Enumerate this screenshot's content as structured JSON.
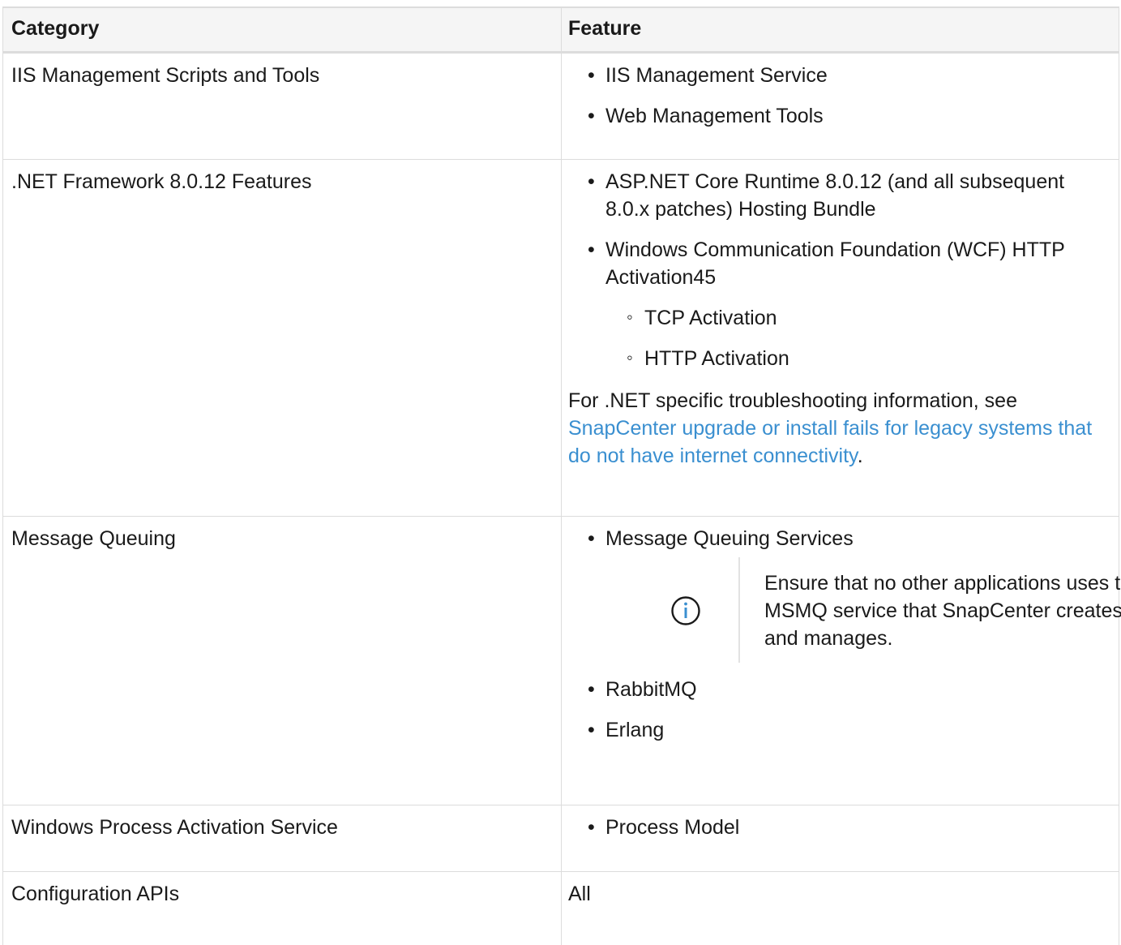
{
  "table": {
    "headers": {
      "category": "Category",
      "feature": "Feature"
    },
    "rows": [
      {
        "category": "IIS Management Scripts and Tools",
        "features": [
          "IIS Management Service",
          "Web Management Tools"
        ]
      },
      {
        "category": ".NET Framework 8.0.12 Features",
        "features": [
          "ASP.NET Core Runtime 8.0.12 (and all subsequent 8.0.x patches) Hosting Bundle",
          "Windows Communication Foundation (WCF) HTTP Activation45"
        ],
        "subfeatures": [
          "TCP Activation",
          "HTTP Activation"
        ],
        "note_prefix": "For .NET specific troubleshooting information, see ",
        "note_link": "SnapCenter upgrade or install fails for legacy systems that do not have internet connectivity",
        "note_suffix": "."
      },
      {
        "category": "Message Queuing",
        "features": [
          "Message Queuing Services",
          "RabbitMQ",
          "Erlang"
        ],
        "admonition": "Ensure that no other applications uses the MSMQ service that SnapCenter creates and manages."
      },
      {
        "category": "Windows Process Activation Service",
        "features": [
          "Process Model"
        ]
      },
      {
        "category": "Configuration APIs",
        "feature_text": "All"
      }
    ]
  },
  "colors": {
    "link": "#3a8fd0",
    "border": "#dcdcdc",
    "header_bg": "#f5f5f5",
    "text": "#1a1a1a"
  },
  "icons": {
    "admonition": "info-icon"
  }
}
